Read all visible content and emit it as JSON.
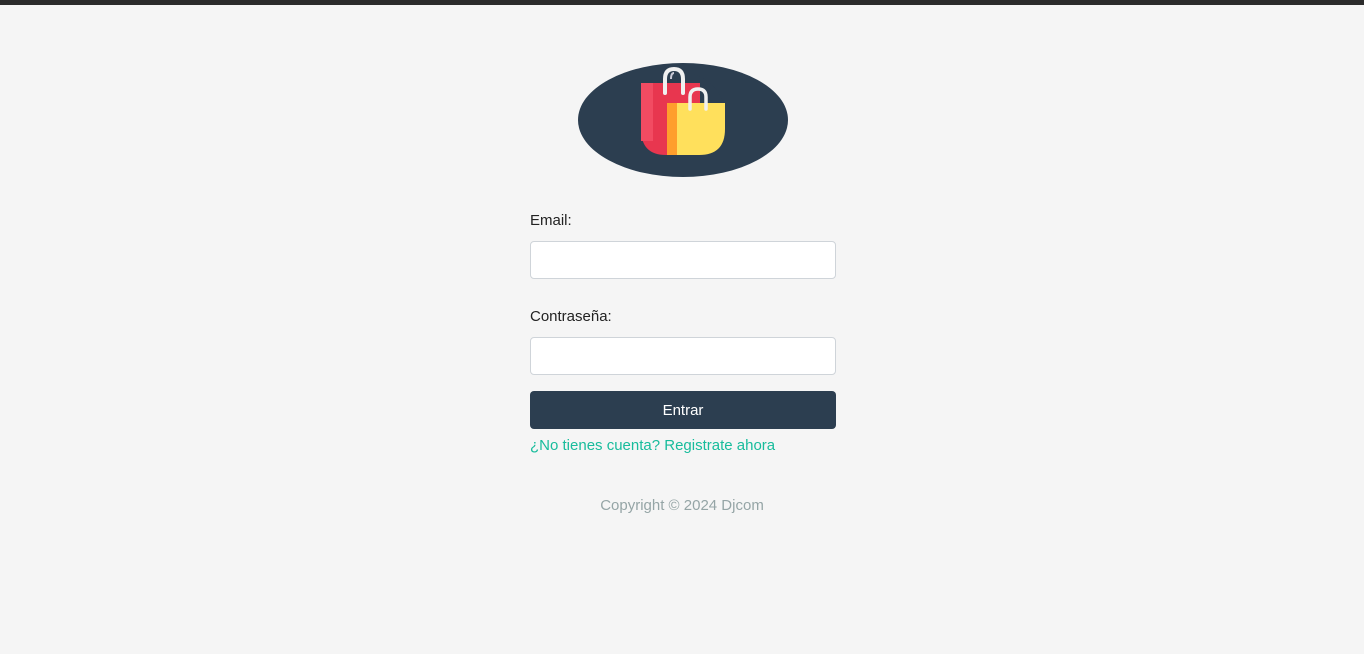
{
  "brand": {
    "logo_icon": "shopping-bags-icon",
    "colors": {
      "primary": "#2c3e50",
      "link": "#18bc9c",
      "muted": "#95a5a6",
      "background": "#f5f5f5"
    }
  },
  "login": {
    "email_label": "Email:",
    "email_value": "",
    "password_label": "Contraseña:",
    "password_value": "",
    "submit_label": "Entrar",
    "register_link": "¿No tienes cuenta? Registrate ahora"
  },
  "footer": {
    "copyright": "Copyright © 2024 Djcom"
  }
}
